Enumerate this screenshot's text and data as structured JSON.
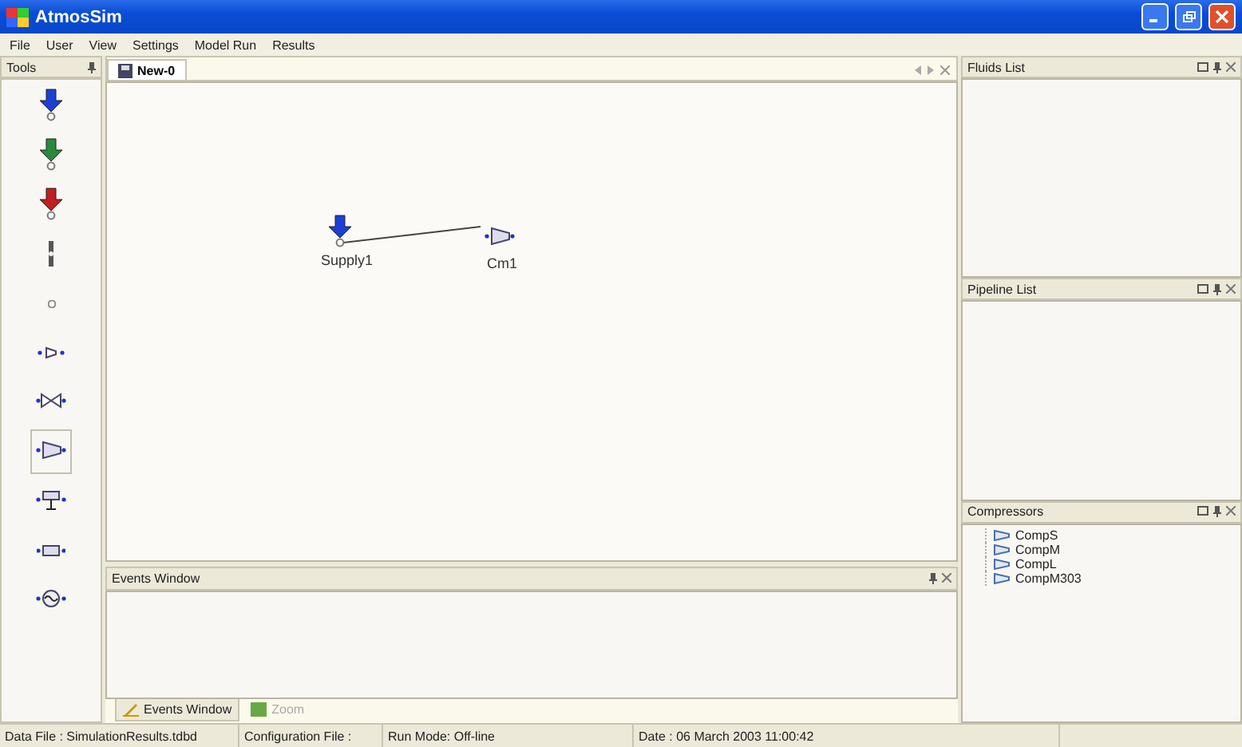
{
  "window": {
    "title": "AtmosSim"
  },
  "menu": [
    "File",
    "User",
    "View",
    "Settings",
    "Model Run",
    "Results"
  ],
  "tools_panel": {
    "title": "Tools",
    "items": [
      {
        "kind": "supply",
        "selected": false
      },
      {
        "kind": "delivery",
        "selected": false
      },
      {
        "kind": "offtake",
        "selected": false
      },
      {
        "kind": "link",
        "selected": false
      },
      {
        "kind": "node",
        "selected": false
      },
      {
        "kind": "small-compressor",
        "selected": false
      },
      {
        "kind": "valve",
        "selected": false
      },
      {
        "kind": "compressor",
        "selected": true
      },
      {
        "kind": "cooler",
        "selected": false
      },
      {
        "kind": "pipe",
        "selected": false
      },
      {
        "kind": "regulator",
        "selected": false
      }
    ]
  },
  "document_tabs": [
    {
      "label": "New-0",
      "selected": true
    }
  ],
  "canvas": {
    "nodes": [
      {
        "kind": "supply",
        "label": "Supply1"
      },
      {
        "kind": "compressor",
        "label": "Cm1"
      }
    ]
  },
  "events_window": {
    "title": "Events Window"
  },
  "bottom_tabs": [
    {
      "label": "Events Window",
      "selected": true
    },
    {
      "label": "Zoom",
      "selected": false
    }
  ],
  "right_panels": [
    {
      "title": "Fluids List"
    },
    {
      "title": "Pipeline List"
    },
    {
      "title": "Compressors",
      "items": [
        "CompS",
        "CompM",
        "CompL",
        "CompM303"
      ]
    }
  ],
  "status_bar": [
    "Data File : SimulationResults.tdbd",
    "Configuration File :",
    "Run Mode: Off-line",
    "Date : 06 March 2003 11:00:42"
  ]
}
